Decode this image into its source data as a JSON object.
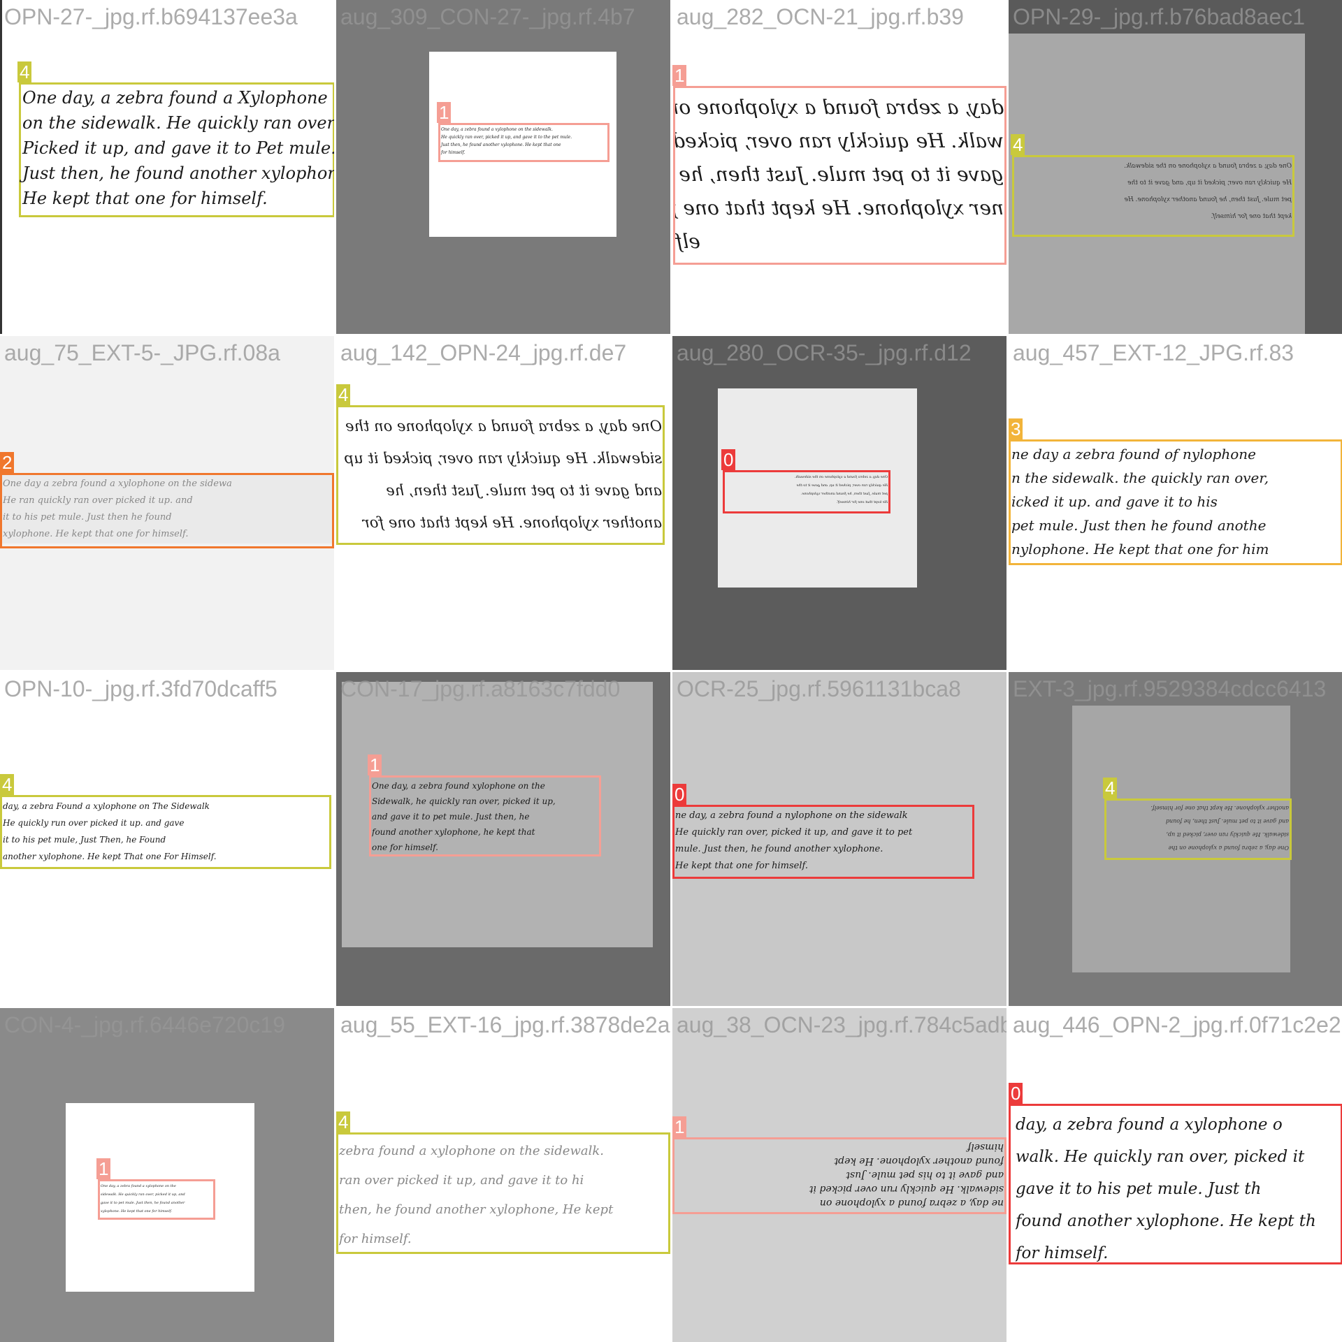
{
  "colors": {
    "class_0": "#ec3b3b",
    "class_1": "#f59e94",
    "class_2": "#f0772d",
    "class_3": "#f2b43a",
    "class_4": "#c9c93c"
  },
  "tiles": [
    {
      "filename": "OPN-27-_jpg.rf.b694137ee3a",
      "label": "4",
      "text": "One day, a zebra found a Xylophone\non the sidewalk. He quickly ran over\nPicked it up, and gave it to Pet mule.\nJust then, he found another xylophone.\nHe kept that one for himself."
    },
    {
      "filename": "aug_309_CON-27-_jpg.rf.4b7",
      "label": "1",
      "text": "One day, a zebra found a xylophone on the sidewalk.\nHe quickly ran over, picked it up, and gave it to the pet mule.\nJust then, he found another xylophone. He kept that one\nfor himself."
    },
    {
      "filename": "aug_282_OCN-21_jpg.rf.b39",
      "label": "1",
      "text": "day, a zebra found a xylophone on t\nwalk. He quickly ran over, picked it up\ngave it to pet mule. Just then, he f\nner xylophone. He kept that one for\nelf"
    },
    {
      "filename": "OPN-29-_jpg.rf.b76bad8aec1",
      "label": "4",
      "text": "One day, a zebra found a xylophone on the sidewalk.\nHe quickly ran over, picked it up, and gave it to the\npet mule. Just then, he found another xylophone. He\nkept that one for himself."
    },
    {
      "filename": "aug_75_EXT-5-_JPG.rf.08a",
      "label": "2",
      "text": "One day a zebra found a xylophone on the sidewa\nHe ran quickly ran over picked it up. and\nit to his pet mule. Just then he found\nxylophone. He kept that one for himself."
    },
    {
      "filename": "aug_142_OPN-24_jpg.rf.de7",
      "label": "4",
      "text": "One day, a zebra found a xylophone on the\nsidewalk. He quickly ran over, picked it up\nand gave it to pet mule. Just then, he\nanother xylophone. He kept that one for"
    },
    {
      "filename": "aug_280_OCR-35-_jpg.rf.d12",
      "label": "0",
      "text": "One day, a zebra found a xylophone on the sidewalk.\nHe quickly ran over, picked it up, and gave it to the\npet mule. Just then, he found another xylophone.\nHe kept that one for himself."
    },
    {
      "filename": "aug_457_EXT-12_JPG.rf.83",
      "label": "3",
      "text": "ne day a zebra found of nylophone\nn the sidewalk. the quickly ran over,\nicked it up. and gave it to his\npet mule. Just then he found anothe\nnylophone. He kept that one for him"
    },
    {
      "filename": "OPN-10-_jpg.rf.3fd70dcaff5",
      "label": "4",
      "text": "day, a zebra Found a xylophone on The Sidewalk\nHe quickly run over picked it up. and gave\nit to his pet mule, Just Then, he Found\nanother xylophone. He kept That one For Himself."
    },
    {
      "filename": "CON-17_jpg.rf.a8163c7fdd0",
      "label": "1",
      "text": "One day, a zebra found xylophone on the\nSidewalk, he quickly ran over, picked it up,\nand gave it to pet mule. Just then, he\nfound another xylophone, he kept that\none for himself."
    },
    {
      "filename": "OCR-25_jpg.rf.5961131bca8",
      "label": "0",
      "text": "ne day, a zebra found a nylophone on the sidewalk\nHe quickly ran over, picked it up, and gave it to pet\nmule. Just then, he found another xylophone.\nHe kept that one for himself."
    },
    {
      "filename": "EXT-3_jpg.rf.9529384cdcc6413",
      "label": "4",
      "text": "One day, a zebra found a xylophone on the\nsidewalk. He quickly ran over, picked it up,\nand gave it to pet mule. Just then, he found\nanother xylophone. He kept that one for himself."
    },
    {
      "filename": "CON-4-_jpg.rf.6446e720c19",
      "label": "1",
      "text": "One day, a zebra found a xylophone on the\nsidewalk. He quickly ran over, picked it up, and\ngave it to pet mule. Just then, he found another\nxylophone. He kept that one for himself."
    },
    {
      "filename": "aug_55_EXT-16_jpg.rf.3878de2a",
      "label": "4",
      "text": "zebra found a xylophone on the sidewalk.\nran over picked it up, and gave it to hi\nthen, he found another xylophone, He kept\nfor himself."
    },
    {
      "filename": "aug_38_OCN-23_jpg.rf.784c5adb93",
      "label": "1",
      "text": "ne day, a zebra found a xylophone on\nsidewalk. He quickly run over picked it\nand gave it to his pet mule. Just\nfound another xylophone. He kept\nhimself"
    },
    {
      "filename": "aug_446_OPN-2_jpg.rf.0f71c2e2dc",
      "label": "0",
      "text": "day, a zebra found a xylophone o\nwalk. He quickly ran over, picked it\ngave it to his pet mule. Just th\nfound another xylophone. He kept th\nfor himself."
    }
  ]
}
